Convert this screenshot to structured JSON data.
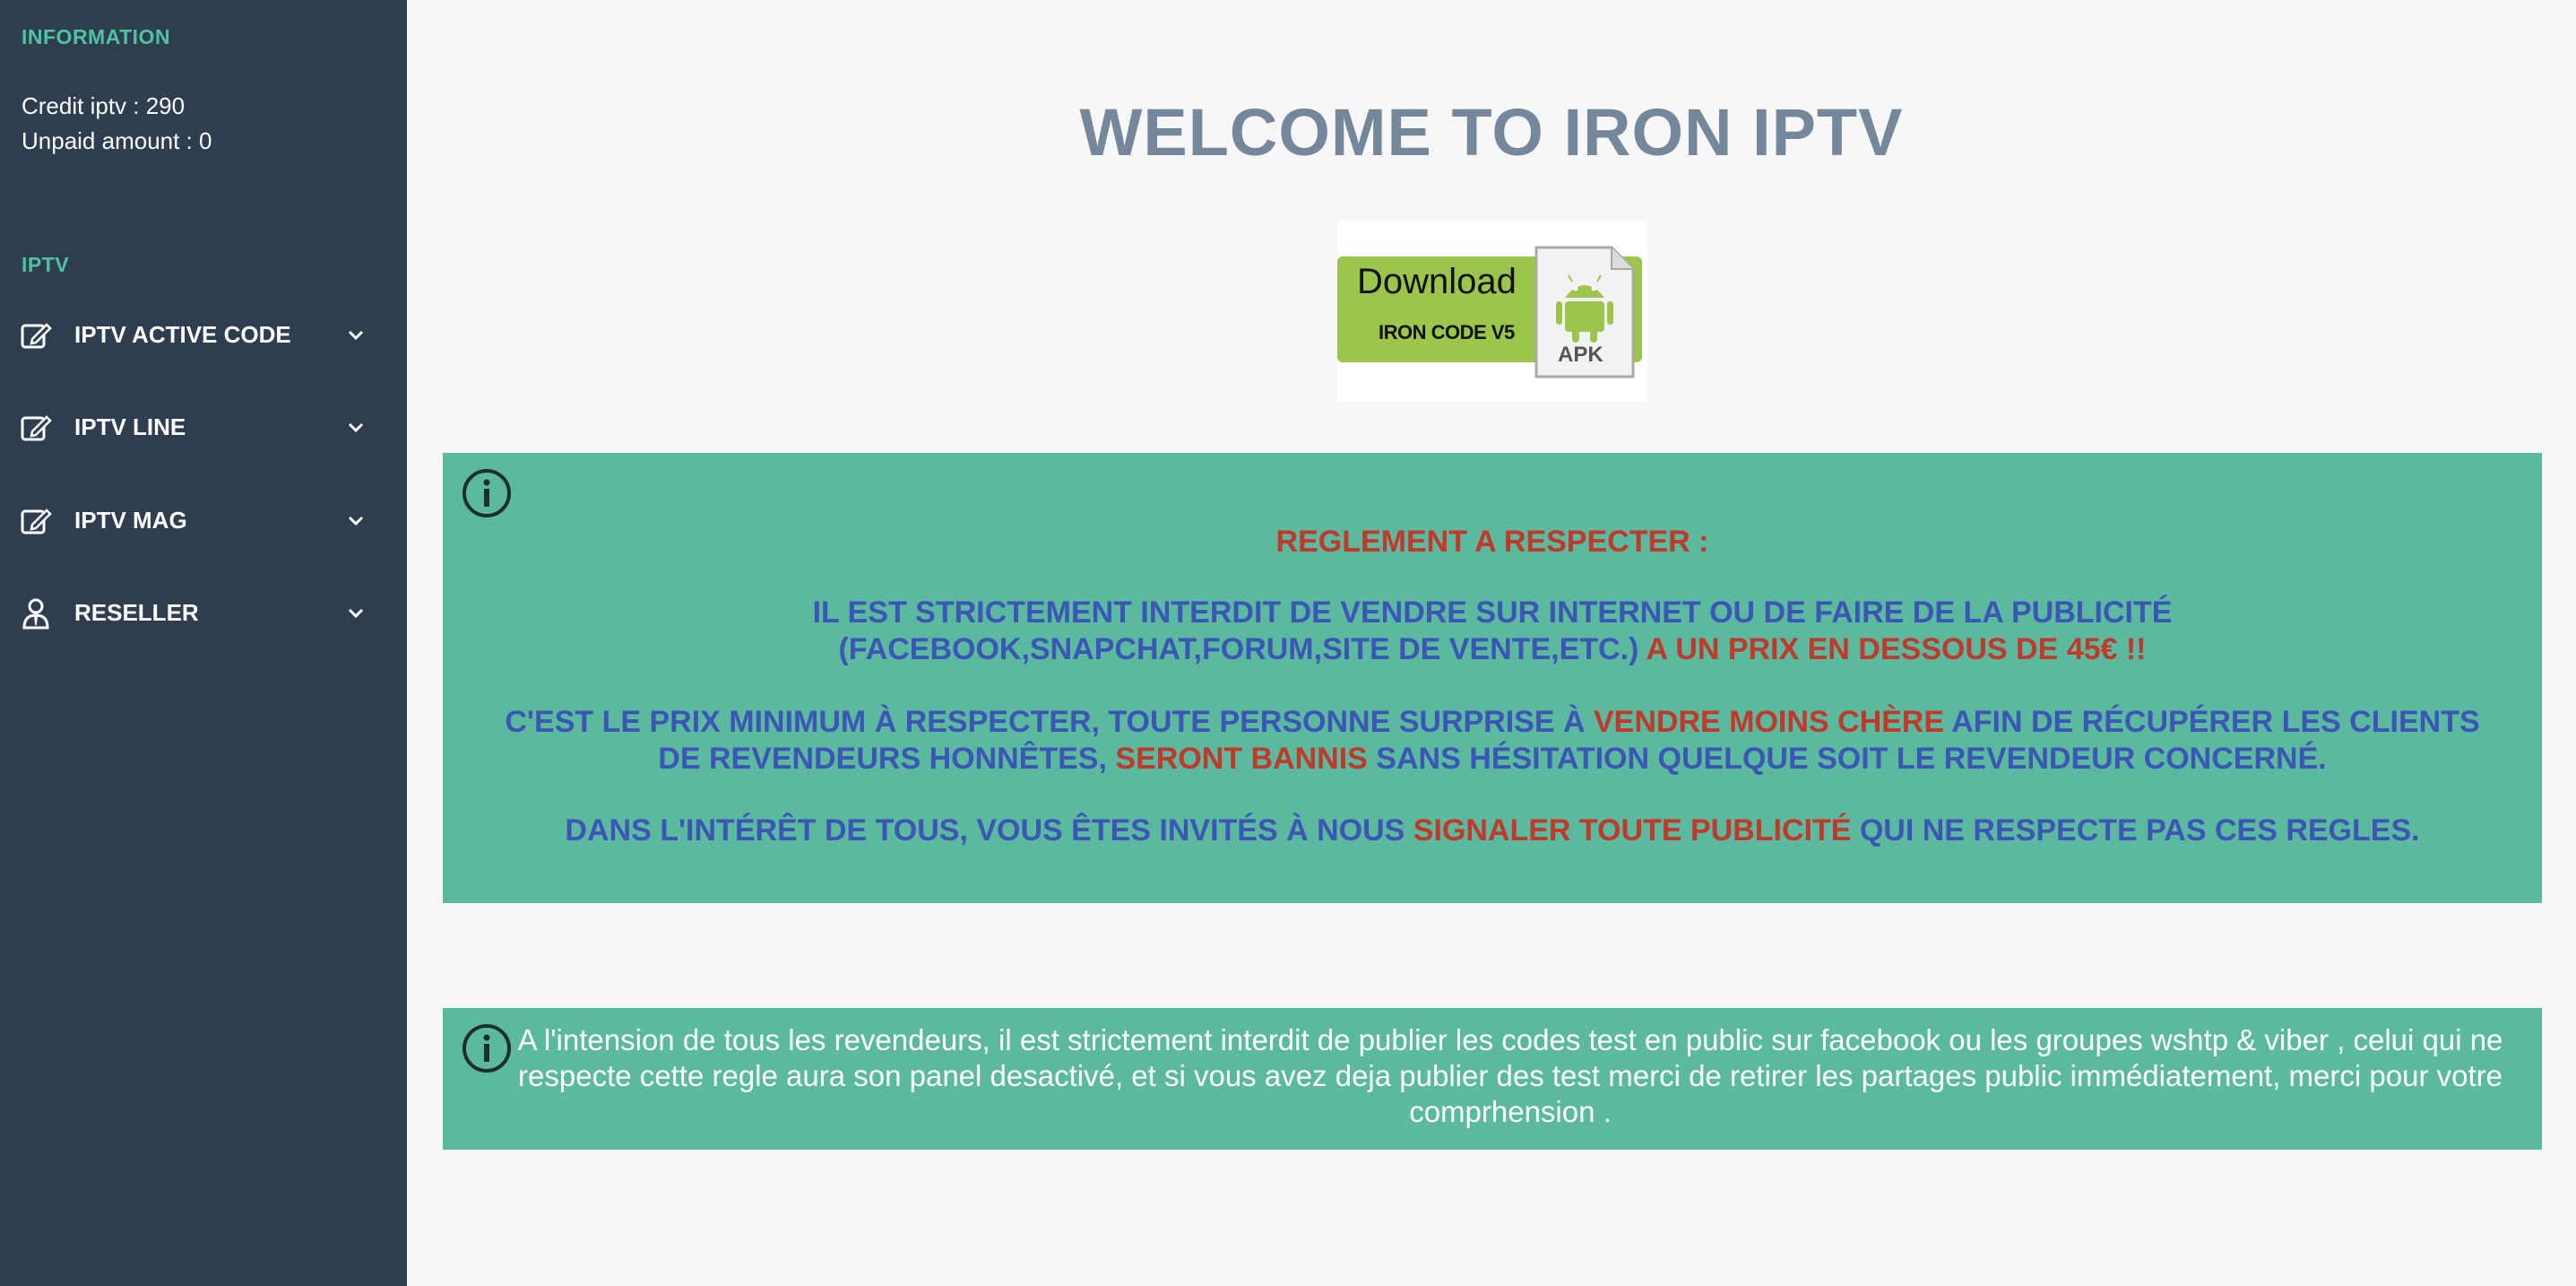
{
  "sidebar": {
    "information_title": "INFORMATION",
    "credit_line": "Credit iptv : 290",
    "unpaid_line": "Unpaid amount : 0",
    "iptv_title": "IPTV",
    "items": [
      {
        "label": "IPTV ACTIVE CODE",
        "icon": "edit-icon"
      },
      {
        "label": "IPTV LINE",
        "icon": "edit-icon"
      },
      {
        "label": "IPTV MAG",
        "icon": "edit-icon"
      },
      {
        "label": "RESELLER",
        "icon": "user-tie-icon"
      }
    ]
  },
  "main": {
    "welcome": "WELCOME TO IRON IPTV",
    "apk_banner": {
      "download": "Download",
      "subtitle": "IRON CODE V5",
      "file_label": "APK"
    },
    "rules": {
      "title": "REGLEMENT A RESPECTER :",
      "p1_line1": "IL EST STRICTEMENT INTERDIT DE VENDRE SUR INTERNET OU DE FAIRE DE LA PUBLICITÉ",
      "p1_line2_a": "(FACEBOOK,SNAPCHAT,FORUM,SITE DE VENTE,ETC.)",
      "p1_line2_b": " A UN PRIX EN DESSOUS DE  45€ !!",
      "p2_a": "C'EST LE PRIX MINIMUM À RESPECTER, TOUTE PERSONNE SURPRISE À ",
      "p2_b": "VENDRE MOINS CHÈRE",
      "p2_c": " AFIN DE RÉCUPÉRER LES CLIENTS DE REVENDEURS HONNÊTES, ",
      "p2_d": "SERONT BANNIS",
      "p2_e": " SANS HÉSITATION QUELQUE SOIT LE REVENDEUR CONCERNÉ.",
      "p3_a": "DANS L'INTÉRÊT DE TOUS, VOUS ÊTES INVITÉS À NOUS ",
      "p3_b": "SIGNALER TOUTE PUBLICITÉ",
      "p3_c": " QUI NE RESPECTE PAS CES REGLES."
    },
    "notice2": "A l'intension de tous les revendeurs, il est strictement interdit de publier les codes test en public sur facebook ou les groupes wshtp & viber , celui qui ne respecte cette regle aura son panel desactivé, et si vous avez deja publier des test merci de retirer les partages public immédiatement, merci pour votre comprhension ."
  },
  "colors": {
    "sidebar_bg": "#2e3e50",
    "accent": "#4fc3a1",
    "notice_bg": "#5ab99e",
    "rule_blue": "#3c56b5",
    "rule_red": "#c0392b",
    "welcome": "#75879b"
  }
}
